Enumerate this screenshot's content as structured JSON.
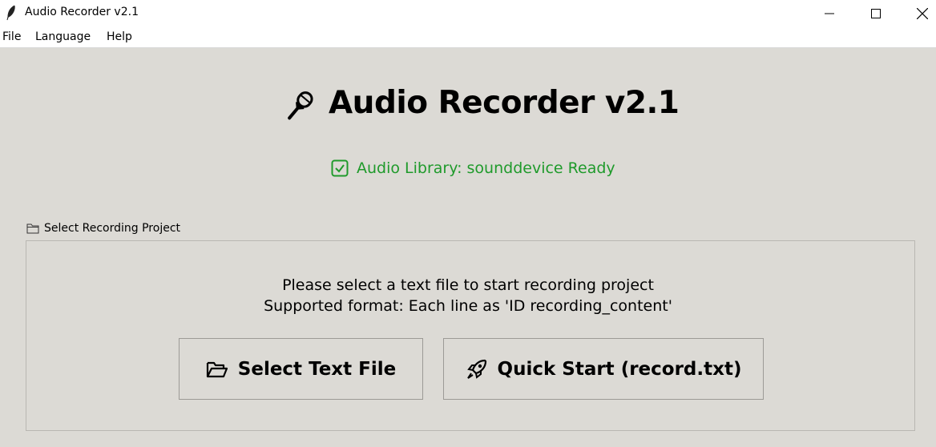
{
  "window": {
    "title": "Audio Recorder v2.1"
  },
  "menubar": {
    "items": [
      "File",
      "Language",
      "Help"
    ]
  },
  "heading": {
    "icon": "microphone-icon",
    "text": "Audio Recorder v2.1"
  },
  "status": {
    "icon": "check-box-icon",
    "text": "Audio Library: sounddevice Ready",
    "color": "#1f9a2b"
  },
  "project_group": {
    "icon": "folder-icon",
    "label": "Select Recording Project",
    "instruction_line1": "Please select a text file to start recording project",
    "instruction_line2": "Supported format: Each line as 'ID recording_content'",
    "select_button": {
      "icon": "open-folder-icon",
      "label": "Select Text File"
    },
    "quick_button": {
      "icon": "rocket-icon",
      "label": "Quick Start (record.txt)"
    }
  }
}
